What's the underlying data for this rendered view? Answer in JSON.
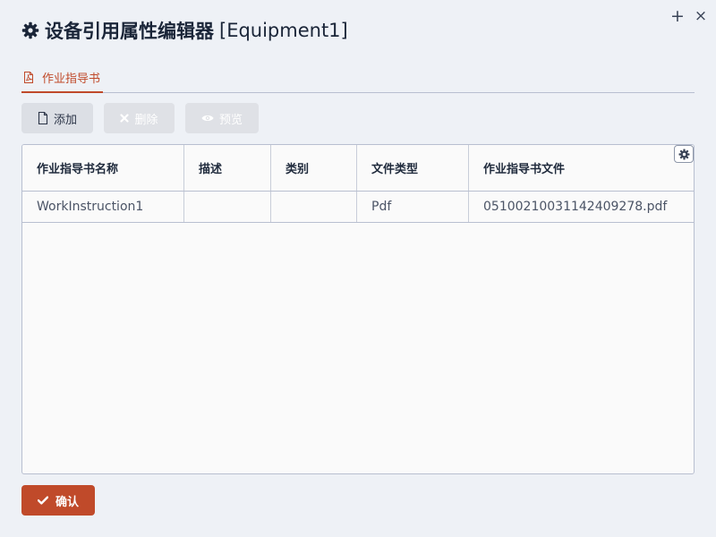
{
  "window": {
    "title": "设备引用属性编辑器",
    "subject": "[Equipment1]",
    "maximize_glyph": "+",
    "close_glyph": "×"
  },
  "tabs": [
    {
      "label": "作业指导书",
      "icon": "pdf-file-icon",
      "active": true
    }
  ],
  "toolbar": {
    "add_label": "添加",
    "delete_label": "删除",
    "preview_label": "预览"
  },
  "table": {
    "columns": [
      "作业指导书名称",
      "描述",
      "类别",
      "文件类型",
      "作业指导书文件"
    ],
    "rows": [
      {
        "name": "WorkInstruction1",
        "description": "",
        "category": "",
        "file_type": "Pdf",
        "file": "05100210031142409278.pdf"
      }
    ]
  },
  "footer": {
    "confirm_label": "确认"
  },
  "colors": {
    "accent": "#c04a2a",
    "background": "#eef1f6",
    "border": "#b8bfd0"
  }
}
